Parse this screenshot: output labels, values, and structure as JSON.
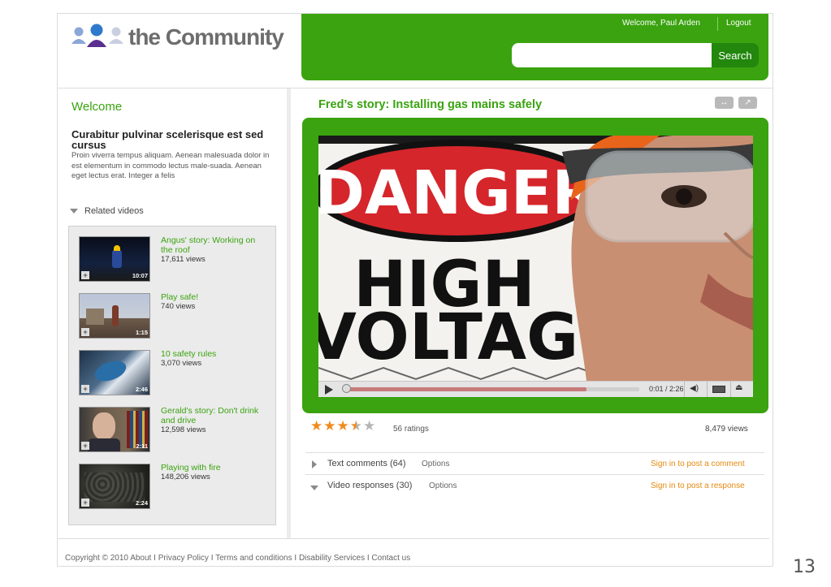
{
  "brand": {
    "name": "the Community"
  },
  "header": {
    "welcome": "Welcome, Paul Arden",
    "logout": "Logout"
  },
  "search": {
    "placeholder": "",
    "button": "Search"
  },
  "sidebar": {
    "welcome": "Welcome",
    "heading": "Curabitur pulvinar scelerisque est sed cursus",
    "body": "Proin viverra tempus aliquam. Aenean malesuada dolor in est elementum in commodo lectus male-suada. Aenean eget lectus erat. Integer a felis",
    "related_label": "Related videos",
    "related": [
      {
        "title": "Angus' story: Working on the roof",
        "views": "17,611 views",
        "duration": "10:07"
      },
      {
        "title": "Play safe!",
        "views": "740 views",
        "duration": "1:15"
      },
      {
        "title": "10 safety rules",
        "views": "3,070 views",
        "duration": "2:46"
      },
      {
        "title": "Gerald's story: Don't drink and drive",
        "views": "12,598 views",
        "duration": "2:11"
      },
      {
        "title": "Playing with fire",
        "views": "148,206 views",
        "duration": "2:24"
      }
    ]
  },
  "video": {
    "title": "Fred’s story: Installing gas mains safely",
    "sign_top": "DANGER",
    "sign_line1": "HIGH",
    "sign_line2": "VOLTAGE",
    "time": "0:01 / 2:26",
    "progress": 0.82,
    "rating": 3.5,
    "ratings": "56 ratings",
    "views": "8,479 views"
  },
  "comments": {
    "text_label": "Text comments (64)",
    "text_options": "Options",
    "text_signin": "Sign in to post a comment",
    "resp_label": "Video responses (30)",
    "resp_options": "Options",
    "resp_signin": "Sign in to post a response"
  },
  "footer": {
    "copyright": "Copyright © 2010",
    "links": [
      "About",
      "Privacy Policy",
      "Terms and conditions",
      "Disability Services",
      "Contact us"
    ]
  },
  "page_number": "13",
  "colors": {
    "brand_green": "#3aa30f",
    "dark_green": "#22870c",
    "orange": "#e5890f",
    "star": "#f08a1c"
  }
}
